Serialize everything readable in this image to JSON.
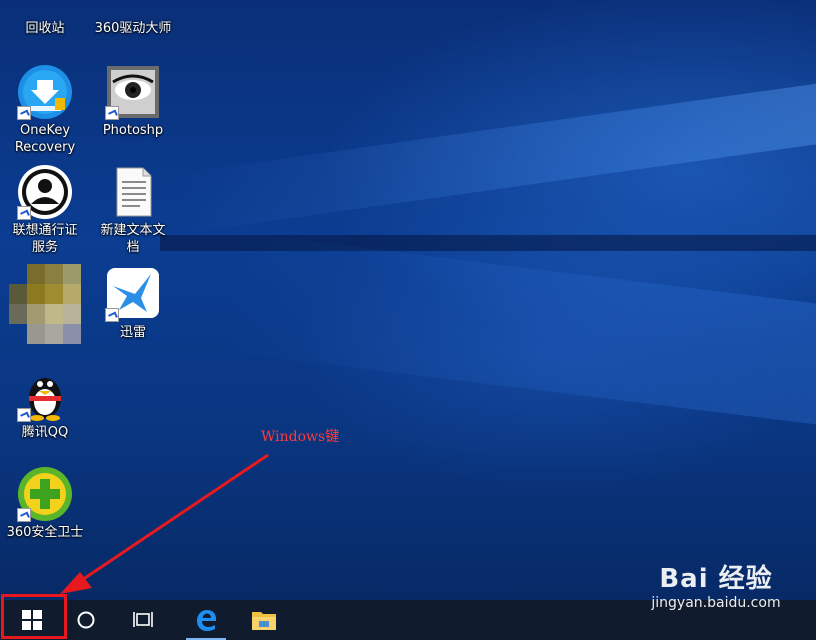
{
  "desktop_icons": [
    {
      "id": "recycle",
      "label": "回收站"
    },
    {
      "id": "driver360",
      "label": "360驱动大师"
    },
    {
      "id": "onekey",
      "label_line1": "OneKey",
      "label_line2": "Recovery"
    },
    {
      "id": "photoshop",
      "label": "Photoshp"
    },
    {
      "id": "lenovo_id",
      "label_line1": "联想通行证",
      "label_line2": "服务"
    },
    {
      "id": "new_text",
      "label_line1": "新建文本文",
      "label_line2": "档"
    },
    {
      "id": "xunlei",
      "label": "迅雷"
    },
    {
      "id": "qq",
      "label": "腾讯QQ"
    },
    {
      "id": "safe360",
      "label": "360安全卫士"
    }
  ],
  "annotation": {
    "text": "Windows键",
    "color": "#ff3b3b"
  },
  "taskbar": {
    "items": [
      "windows-logo-icon",
      "cortana-circle-icon",
      "task-view-icon",
      "edge-icon",
      "file-explorer-icon"
    ]
  },
  "watermark": {
    "line1": "Bai 经验",
    "line2": "jingyan.baidu.com"
  },
  "colors": {
    "highlight": "#e8191e",
    "taskbar": "#101c2e",
    "desktop": "#0b3d92"
  }
}
